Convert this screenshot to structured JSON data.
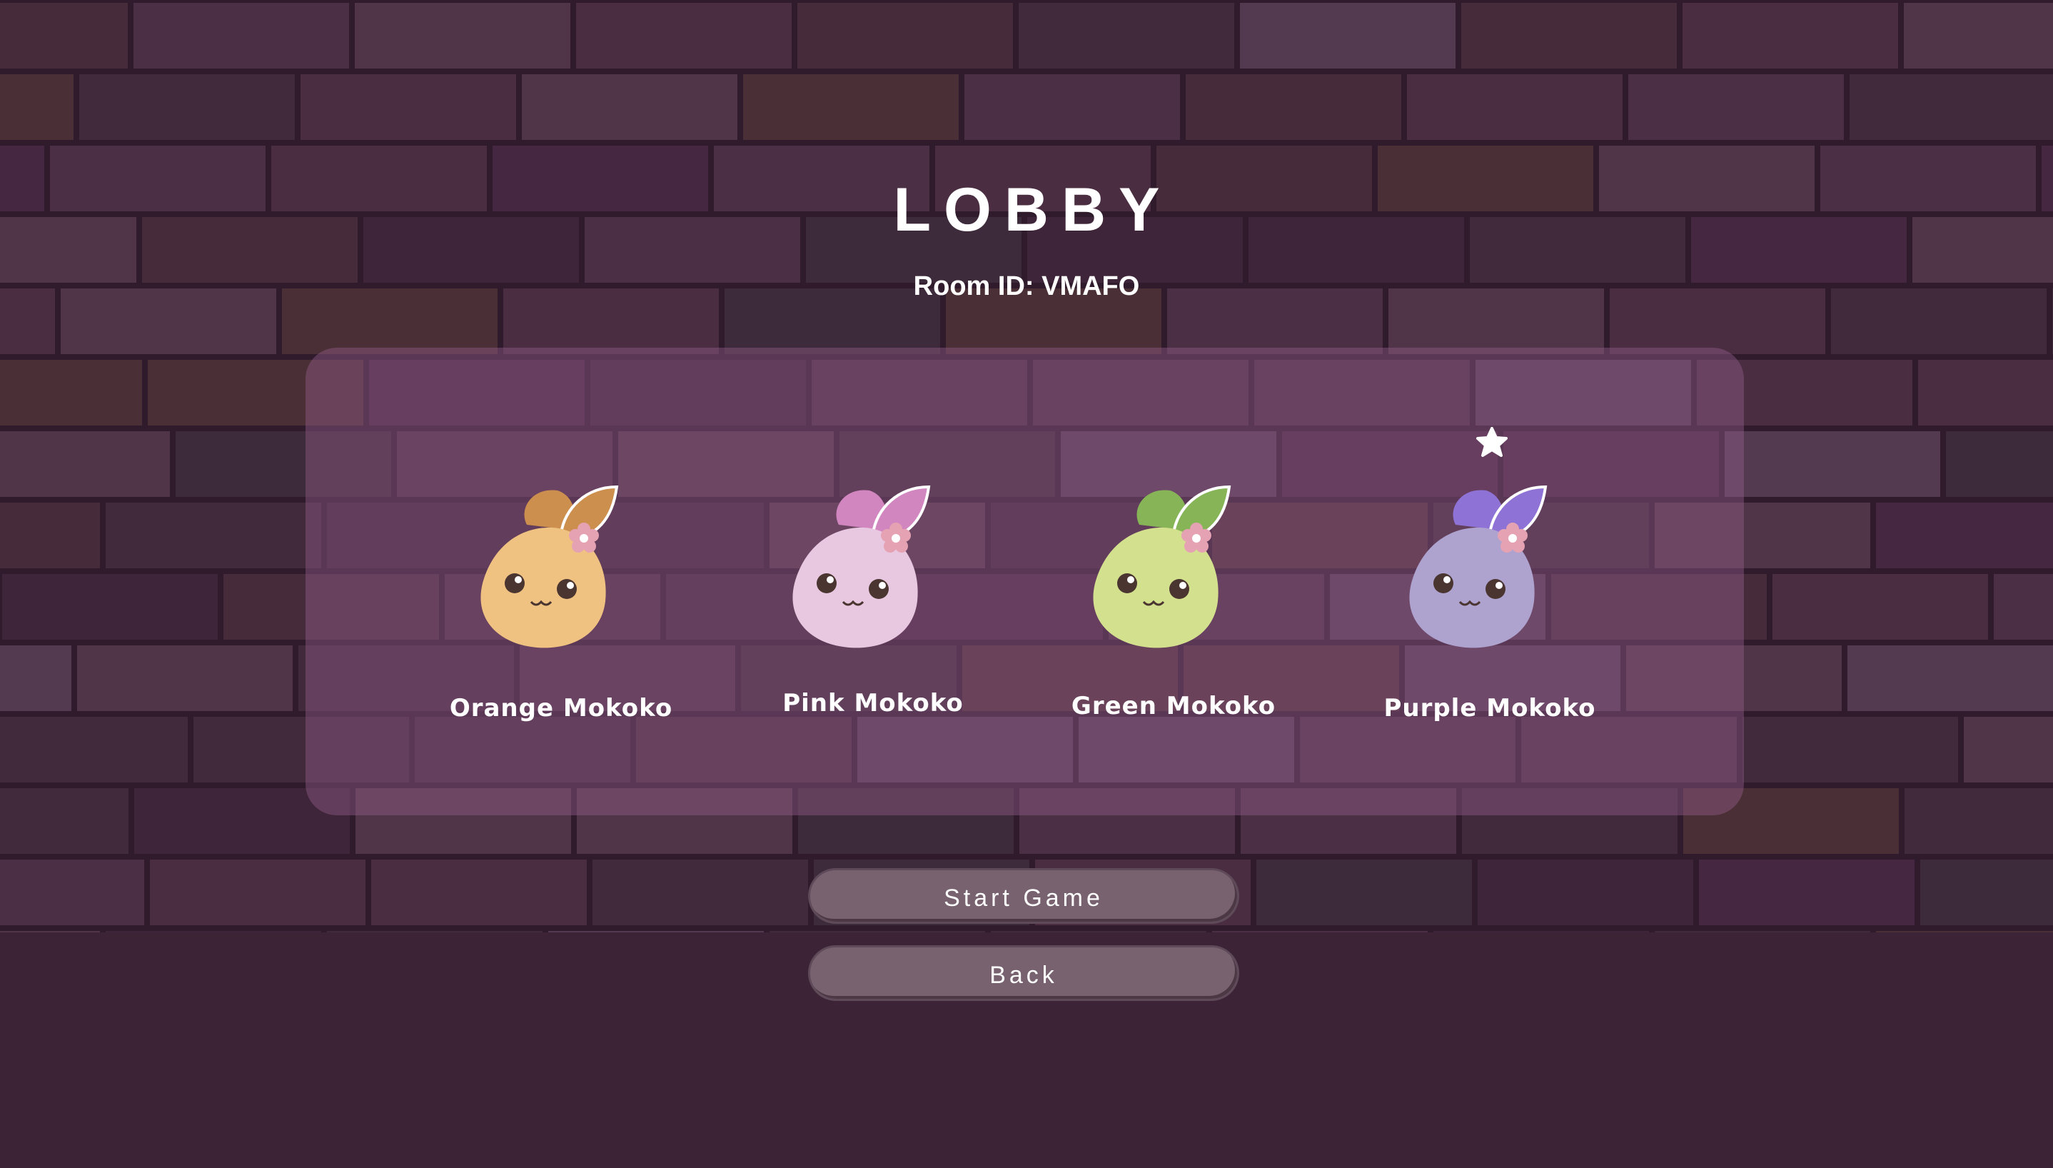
{
  "screen": {
    "title": "LOBBY",
    "room_id_text": "Room ID: VMAFO"
  },
  "characters": [
    {
      "name": "Orange Mokoko",
      "body_color": "#f0c282",
      "leaf_color": "#cc8f4d",
      "selected": false
    },
    {
      "name": "Pink Mokoko",
      "body_color": "#e8c8e0",
      "leaf_color": "#d286c0",
      "selected": false
    },
    {
      "name": "Green Mokoko",
      "body_color": "#d3e08e",
      "leaf_color": "#86b457",
      "selected": false
    },
    {
      "name": "Purple Mokoko",
      "body_color": "#aea2cf",
      "leaf_color": "#8e72d6",
      "selected": true
    }
  ],
  "buttons": {
    "start": "Start Game",
    "back": "Back"
  },
  "selected_marker_icon": "star-icon",
  "colors": {
    "background": "#3c2436",
    "panel": "#8f5e86",
    "button": "#786270",
    "text": "#ffffff"
  }
}
